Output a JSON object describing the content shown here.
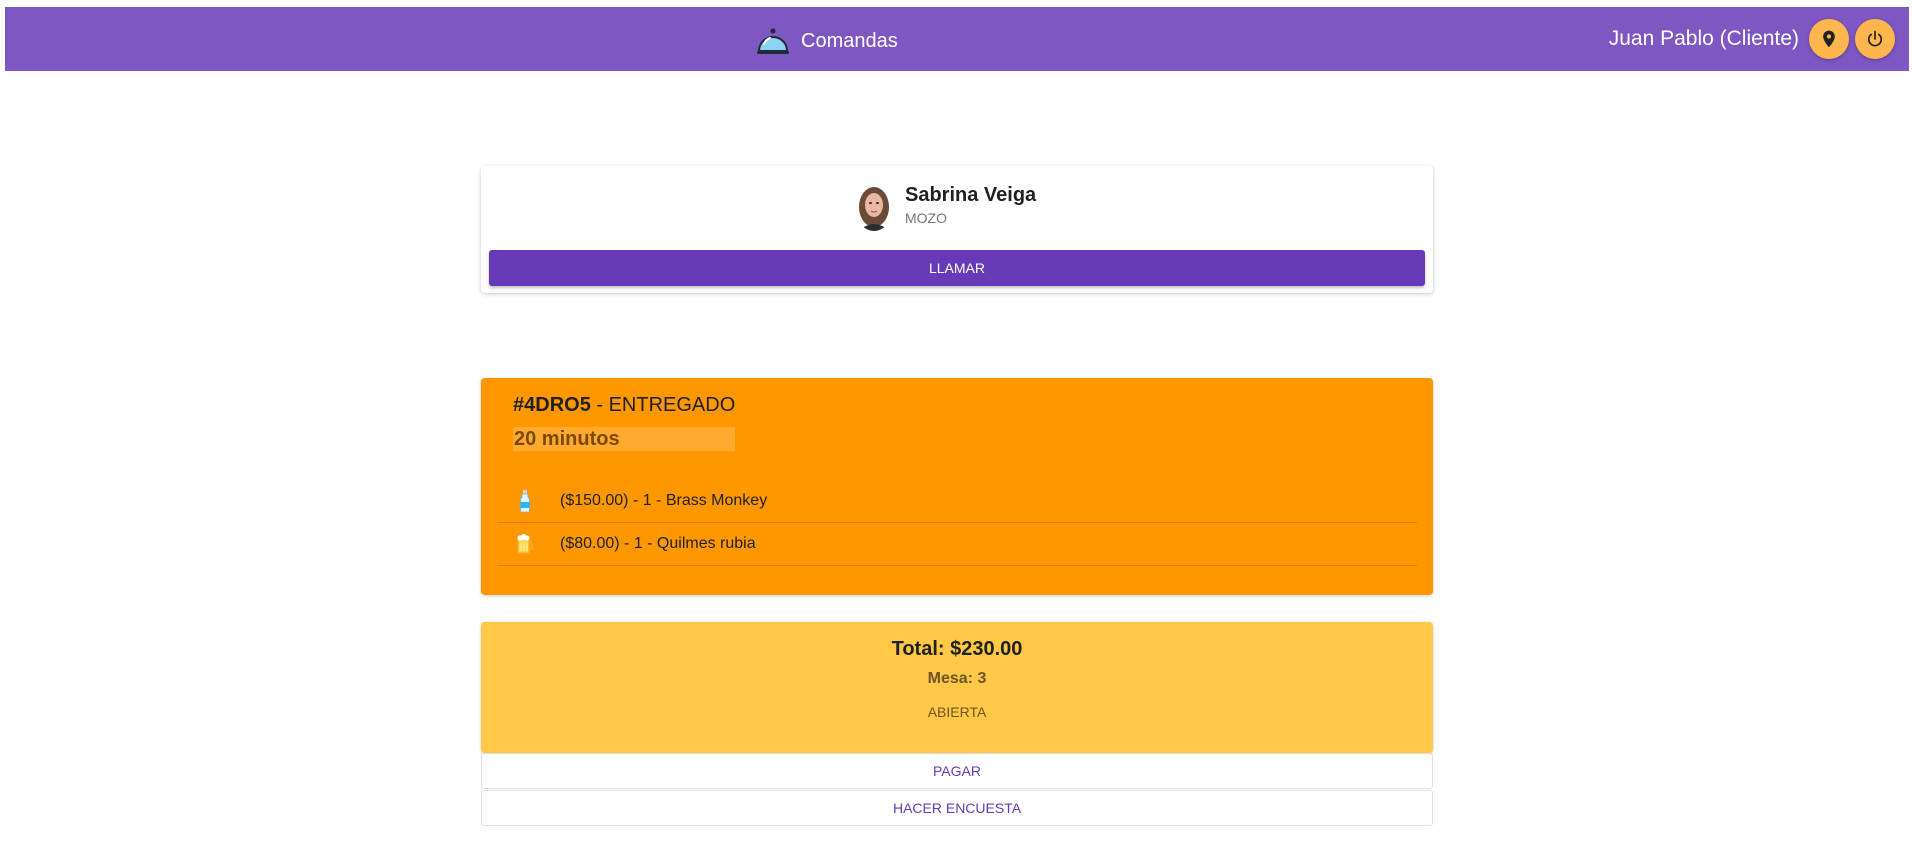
{
  "app": {
    "title": "Comandas"
  },
  "user": {
    "name": "Juan Pablo (Cliente)"
  },
  "header_icons": {
    "location": "location-pin-icon",
    "power": "power-icon",
    "brand": "cloche-icon"
  },
  "waiter": {
    "name": "Sabrina Veiga",
    "role": "MOZO",
    "call_label": "LLAMAR"
  },
  "order": {
    "code": "#4DRO5",
    "separator": " - ",
    "status": "ENTREGADO",
    "time": "20 minutos",
    "items": [
      {
        "text": "($150.00) - 1 - Brass Monkey",
        "icon": "bottle-icon"
      },
      {
        "text": "($80.00) - 1 - Quilmes rubia",
        "icon": "beer-mug-icon"
      }
    ]
  },
  "summary": {
    "total": "Total: $230.00",
    "table": "Mesa: 3",
    "status": "ABIERTA"
  },
  "actions": {
    "pay_label": "PAGAR",
    "survey_label": "HACER ENCUESTA"
  },
  "colors": {
    "header": "#7e57c2",
    "accent": "#673ab7",
    "order_bg": "#ff9800",
    "total_bg": "#ffc847",
    "icon_btn": "#ffb74d"
  }
}
